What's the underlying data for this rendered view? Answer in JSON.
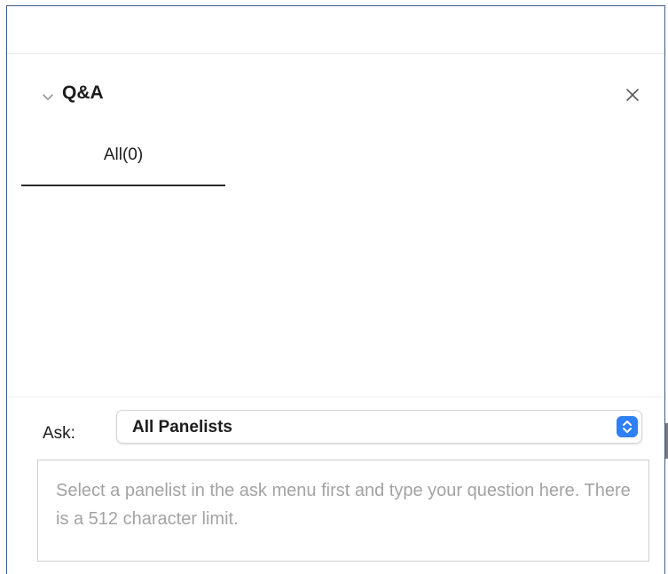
{
  "panel": {
    "title": "Q&A",
    "close_icon": "close-icon",
    "collapse_icon": "chevron-down-icon"
  },
  "tabs": [
    {
      "label": "All(0)",
      "active": true
    }
  ],
  "ask": {
    "label": "Ask:",
    "selected": "All Panelists",
    "select_icon": "updown-chevron-icon"
  },
  "question": {
    "placeholder": "Select a panelist in the ask menu first and type your question here. There is a 512 character limit."
  },
  "colors": {
    "frame_border": "#3b5a86",
    "select_accent": "#2f7ff6",
    "placeholder_text": "#a3a3a3"
  }
}
